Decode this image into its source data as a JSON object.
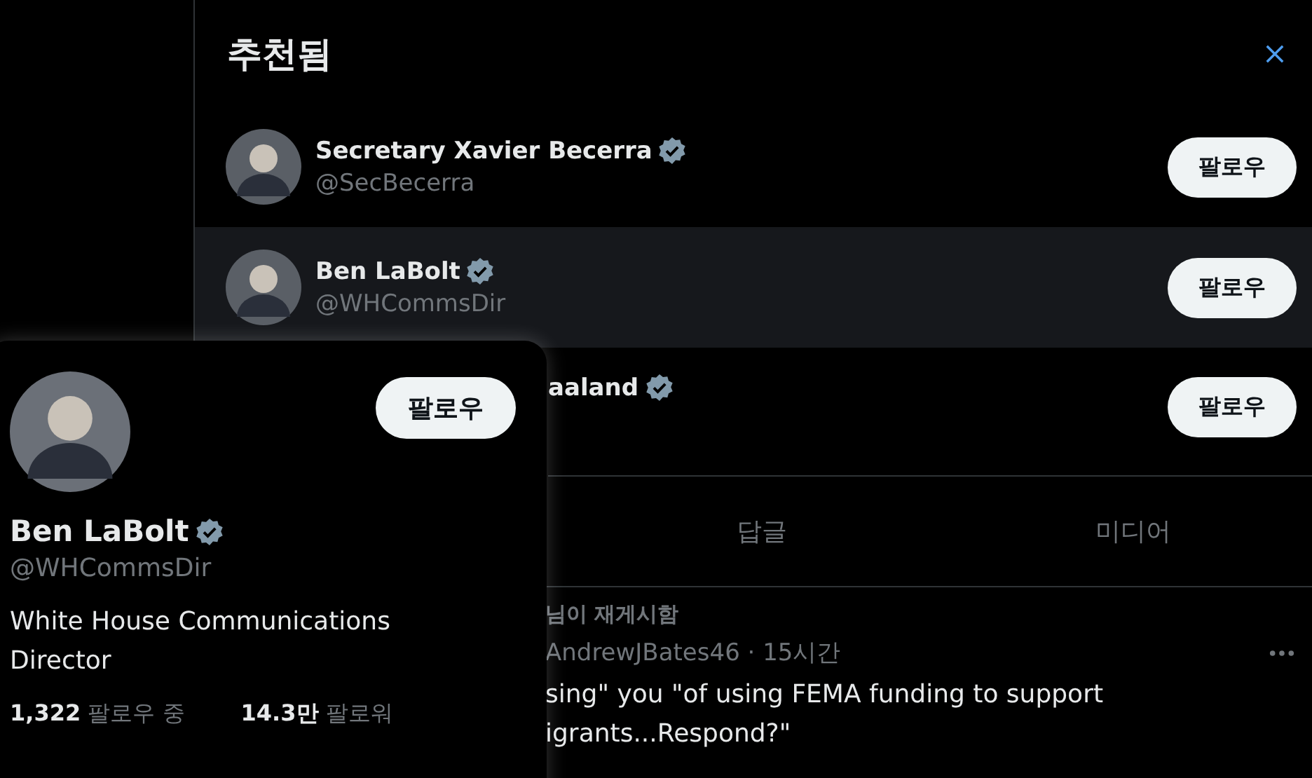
{
  "suggestions": {
    "title": "추천됨",
    "items": [
      {
        "name": "Secretary Xavier Becerra",
        "handle": "@SecBecerra",
        "verified": true,
        "hovered": false,
        "button": "팔로우"
      },
      {
        "name": "Ben LaBolt",
        "handle": "@WHCommsDir",
        "verified": true,
        "hovered": true,
        "button": "팔로우"
      },
      {
        "name": "aaland",
        "verified": true,
        "hovered": false,
        "button": "팔로우"
      }
    ]
  },
  "tabs": [
    {
      "label": "답글",
      "selected": false
    },
    {
      "label": "미디어",
      "selected": false
    }
  ],
  "post": {
    "repost_label": "님이 재게시함",
    "meta": "AndrewJBates46 · 15시간",
    "text_lines": [
      "sing\" you \"of using FEMA funding to support",
      "igrants...Respond?\""
    ]
  },
  "hover_card": {
    "name": "Ben LaBolt",
    "verified": true,
    "handle": "@WHCommsDir",
    "button": "팔로우",
    "bio": "White House Communications Director",
    "stats": [
      {
        "value": "1,322",
        "label": "팔로우 중"
      },
      {
        "value": "14.3만",
        "label": "팔로워"
      }
    ]
  }
}
